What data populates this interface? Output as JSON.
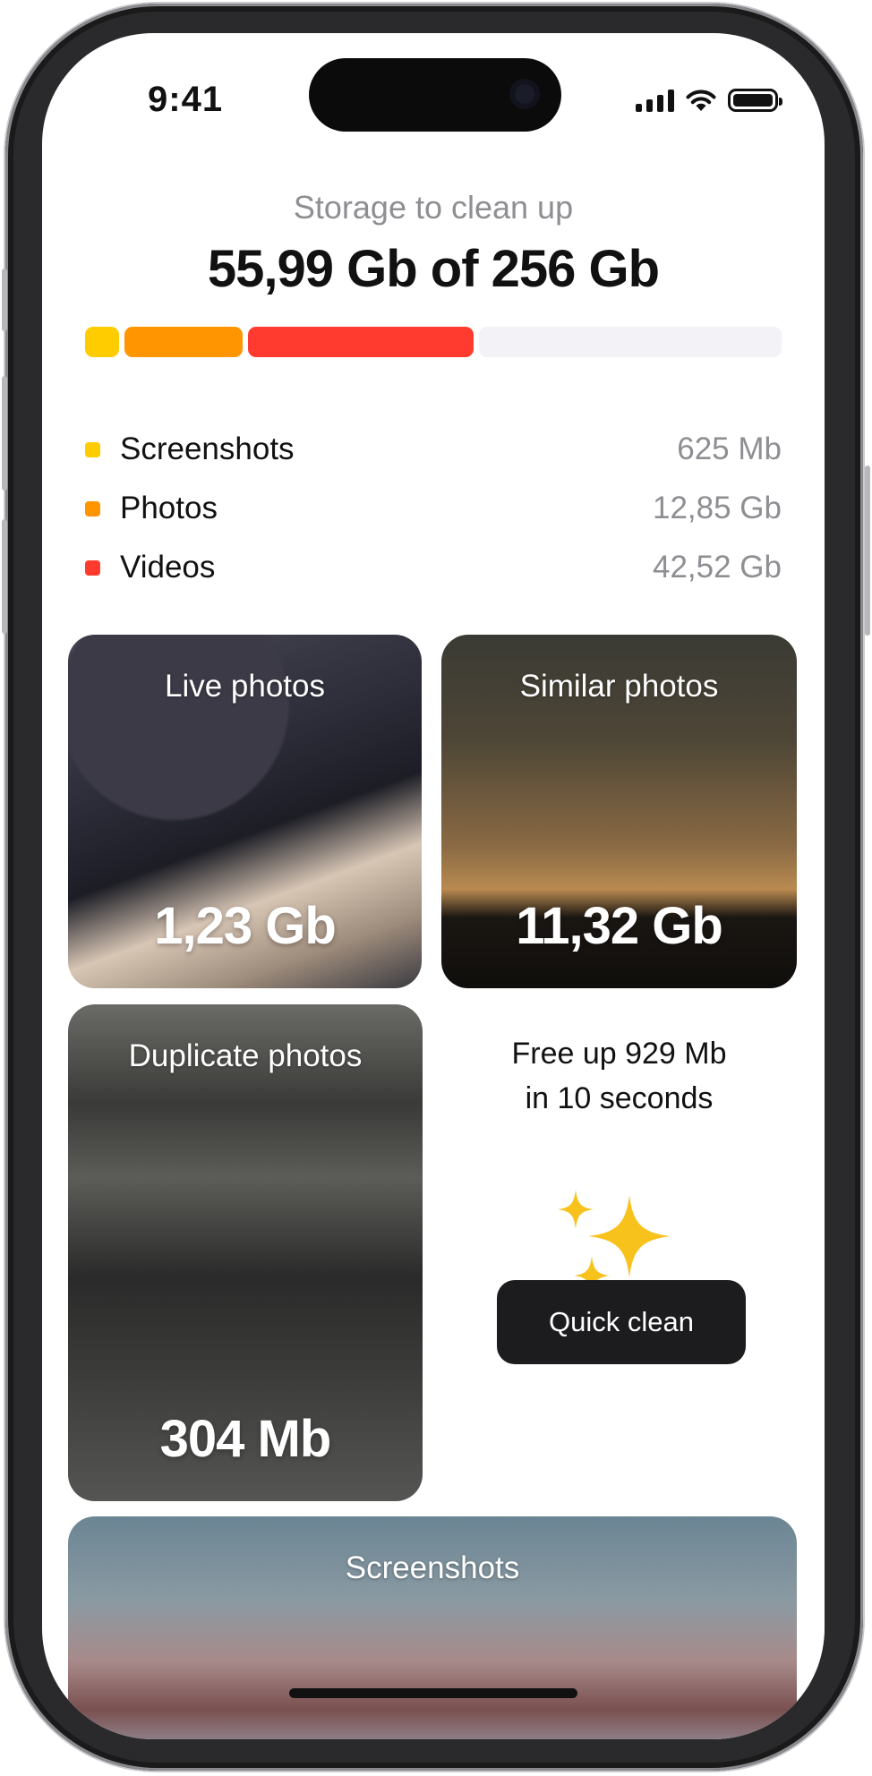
{
  "status_bar": {
    "time": "9:41",
    "icons": [
      "signal-icon",
      "wifi-icon",
      "battery-icon"
    ]
  },
  "storage": {
    "subtitle": "Storage to clean up",
    "title": "55,99 Gb of 256 Gb",
    "usage_fraction": {
      "screenshots": 0.05,
      "photos": 0.17,
      "videos": 0.41,
      "free": 0.37
    },
    "legend": [
      {
        "label": "Screenshots",
        "value": "625 Mb",
        "color": "#FFCC00"
      },
      {
        "label": "Photos",
        "value": "12,85 Gb",
        "color": "#FF9500"
      },
      {
        "label": "Videos",
        "value": "42,52 Gb",
        "color": "#FF3B30"
      }
    ],
    "free_color": "#F2F2F7"
  },
  "cards": {
    "live": {
      "title": "Live photos",
      "value": "1,23 Gb"
    },
    "similar": {
      "title": "Similar photos",
      "value": "11,32 Gb"
    },
    "duplicate": {
      "title": "Duplicate photos",
      "value": "304 Mb"
    },
    "screenshots": {
      "title": "Screenshots"
    }
  },
  "quick_clean": {
    "line1": "Free up 929 Mb",
    "line2": "in 10 seconds",
    "icon": "sparkles-icon",
    "button_label": "Quick clean"
  }
}
